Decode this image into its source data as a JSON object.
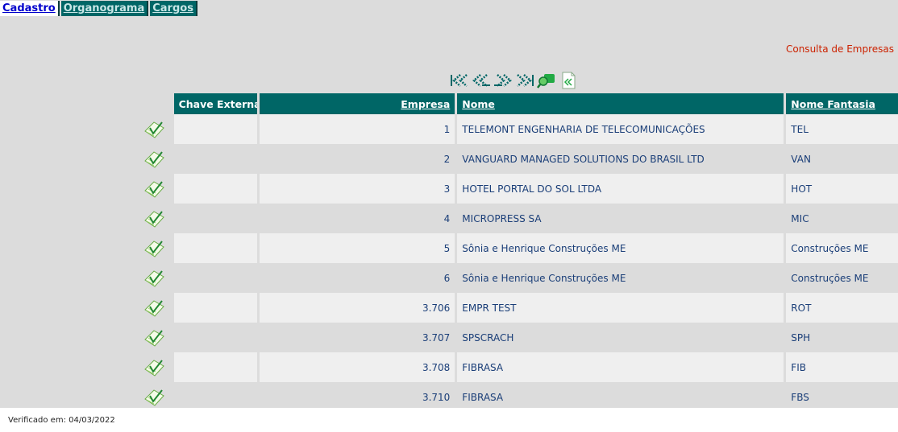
{
  "tabs": [
    {
      "label": "Cadastro",
      "active": true
    },
    {
      "label": "Organograma",
      "active": false
    },
    {
      "label": "Cargos",
      "active": false
    }
  ],
  "page_title": "Consulta de Empresas",
  "pager_icons": [
    "first-page-icon",
    "previous-page-icon",
    "next-page-icon",
    "last-page-icon",
    "search-icon",
    "export-icon"
  ],
  "table": {
    "headers": [
      "",
      "Chave Externa",
      "Empresa",
      "Nome",
      "Nome Fantasia"
    ],
    "rows": [
      {
        "chave": "",
        "empresa": "1",
        "nome": "TELEMONT ENGENHARIA DE TELECOMUNICAÇÕES",
        "fantasia": "TEL"
      },
      {
        "chave": "",
        "empresa": "2",
        "nome": "VANGUARD MANAGED SOLUTIONS DO BRASIL LTD",
        "fantasia": "VAN"
      },
      {
        "chave": "",
        "empresa": "3",
        "nome": "HOTEL PORTAL DO SOL LTDA",
        "fantasia": "HOT"
      },
      {
        "chave": "",
        "empresa": "4",
        "nome": "MICROPRESS SA",
        "fantasia": "MIC"
      },
      {
        "chave": "",
        "empresa": "5",
        "nome": "Sônia e Henrique Construções ME",
        "fantasia": "Construções ME"
      },
      {
        "chave": "",
        "empresa": "6",
        "nome": "Sônia e Henrique Construções ME",
        "fantasia": "Construções ME"
      },
      {
        "chave": "",
        "empresa": "3.706",
        "nome": "EMPR TEST",
        "fantasia": "ROT"
      },
      {
        "chave": "",
        "empresa": "3.707",
        "nome": "SPSCRACH",
        "fantasia": "SPH"
      },
      {
        "chave": "",
        "empresa": "3.708",
        "nome": "FIBRASA",
        "fantasia": "FIB"
      },
      {
        "chave": "",
        "empresa": "3.710",
        "nome": "FIBRASA",
        "fantasia": "FBS"
      }
    ]
  },
  "footer": "Verificado em: 04/03/2022",
  "colors": {
    "header_bg": "#006666",
    "title": "#cc2200",
    "text": "#1a3e78"
  }
}
